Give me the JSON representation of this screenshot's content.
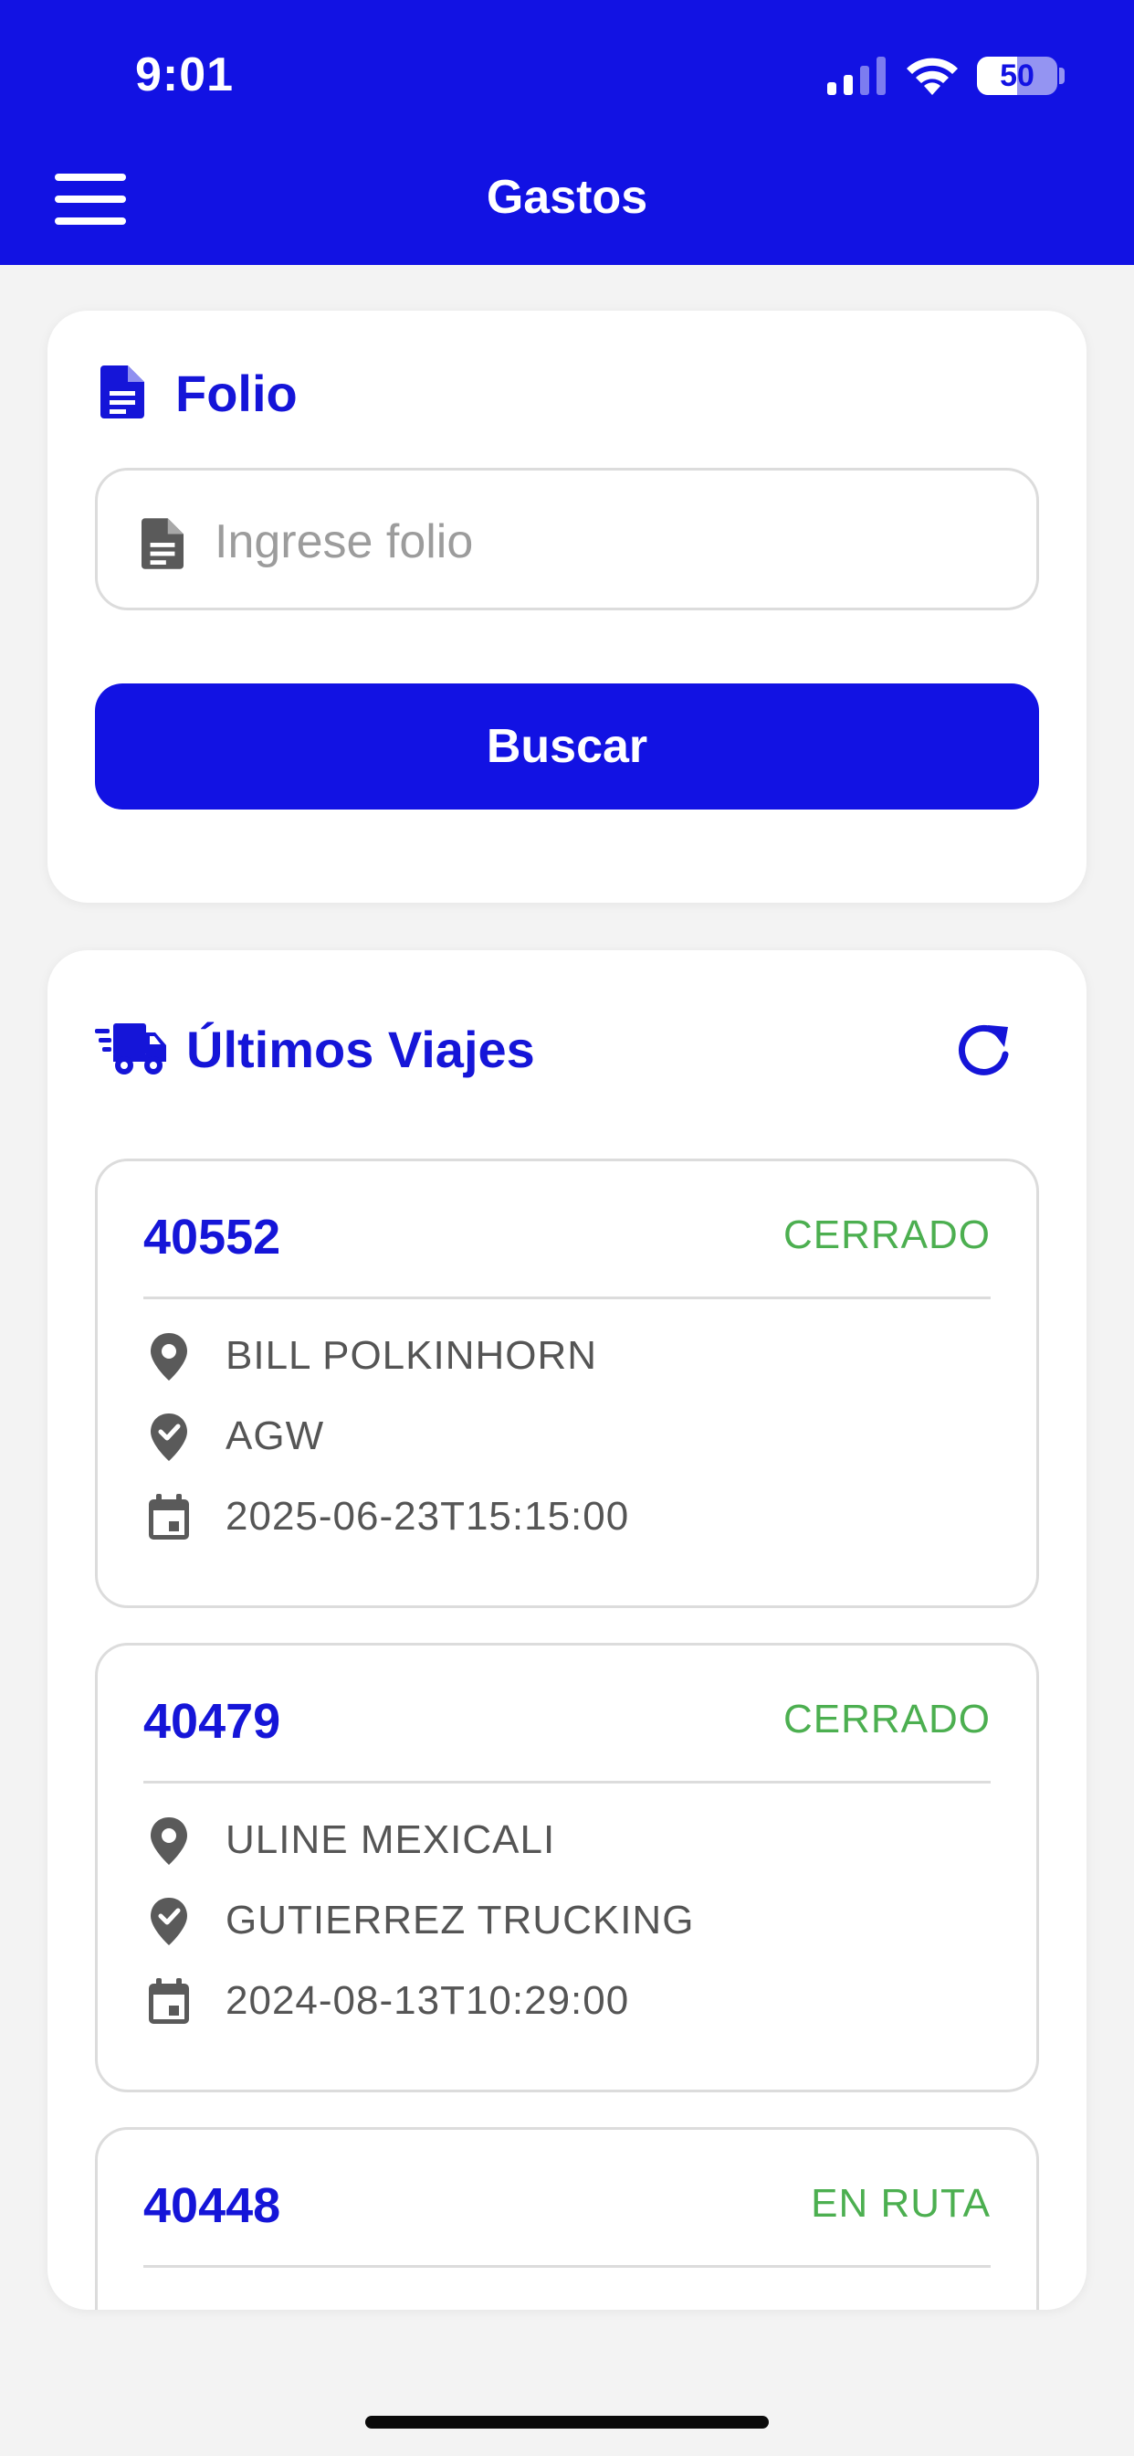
{
  "status_bar": {
    "time": "9:01",
    "battery": "50",
    "battery_level": 0.5,
    "icons": [
      "signal-icon",
      "wifi-icon",
      "battery-icon"
    ]
  },
  "header": {
    "title": "Gastos",
    "menu_icon": "menu-icon",
    "background": "#1212e3"
  },
  "folio": {
    "title": "Folio",
    "icon": "document-icon",
    "placeholder": "Ingrese folio",
    "button_label": "Buscar"
  },
  "viajes": {
    "title": "Últimos Viajes",
    "icon": "truck-icon",
    "refresh_icon": "refresh-icon",
    "trips": [
      {
        "id": "40552",
        "status": "CERRADO",
        "origin": "BILL POLKINHORN",
        "destination": "AGW",
        "date": "2025-06-23T15:15:00"
      },
      {
        "id": "40479",
        "status": "CERRADO",
        "origin": "ULINE MEXICALI",
        "destination": "GUTIERREZ TRUCKING",
        "date": "2024-08-13T10:29:00"
      },
      {
        "id": "40448",
        "status": "EN RUTA"
      }
    ]
  },
  "colors": {
    "accent": "#1212e3",
    "title_text": "#1515d8",
    "status_green": "#4caf50",
    "page_background": "#f3f3f3"
  }
}
